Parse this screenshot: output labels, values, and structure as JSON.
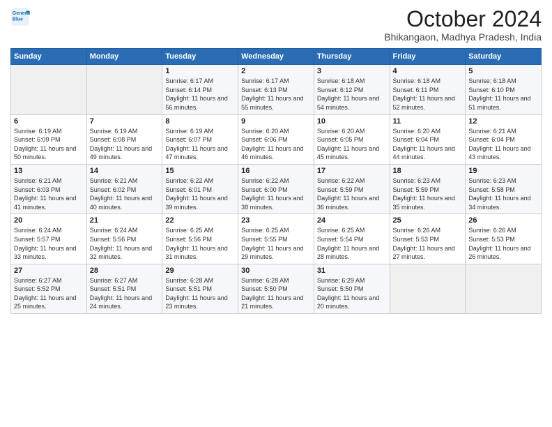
{
  "logo": {
    "line1": "General",
    "line2": "Blue"
  },
  "title": "October 2024",
  "location": "Bhikangaon, Madhya Pradesh, India",
  "header_days": [
    "Sunday",
    "Monday",
    "Tuesday",
    "Wednesday",
    "Thursday",
    "Friday",
    "Saturday"
  ],
  "weeks": [
    [
      {
        "day": "",
        "info": ""
      },
      {
        "day": "",
        "info": ""
      },
      {
        "day": "1",
        "info": "Sunrise: 6:17 AM\nSunset: 6:14 PM\nDaylight: 11 hours and 56 minutes."
      },
      {
        "day": "2",
        "info": "Sunrise: 6:17 AM\nSunset: 6:13 PM\nDaylight: 11 hours and 55 minutes."
      },
      {
        "day": "3",
        "info": "Sunrise: 6:18 AM\nSunset: 6:12 PM\nDaylight: 11 hours and 54 minutes."
      },
      {
        "day": "4",
        "info": "Sunrise: 6:18 AM\nSunset: 6:11 PM\nDaylight: 11 hours and 52 minutes."
      },
      {
        "day": "5",
        "info": "Sunrise: 6:18 AM\nSunset: 6:10 PM\nDaylight: 11 hours and 51 minutes."
      }
    ],
    [
      {
        "day": "6",
        "info": "Sunrise: 6:19 AM\nSunset: 6:09 PM\nDaylight: 11 hours and 50 minutes."
      },
      {
        "day": "7",
        "info": "Sunrise: 6:19 AM\nSunset: 6:08 PM\nDaylight: 11 hours and 49 minutes."
      },
      {
        "day": "8",
        "info": "Sunrise: 6:19 AM\nSunset: 6:07 PM\nDaylight: 11 hours and 47 minutes."
      },
      {
        "day": "9",
        "info": "Sunrise: 6:20 AM\nSunset: 6:06 PM\nDaylight: 11 hours and 46 minutes."
      },
      {
        "day": "10",
        "info": "Sunrise: 6:20 AM\nSunset: 6:05 PM\nDaylight: 11 hours and 45 minutes."
      },
      {
        "day": "11",
        "info": "Sunrise: 6:20 AM\nSunset: 6:04 PM\nDaylight: 11 hours and 44 minutes."
      },
      {
        "day": "12",
        "info": "Sunrise: 6:21 AM\nSunset: 6:04 PM\nDaylight: 11 hours and 43 minutes."
      }
    ],
    [
      {
        "day": "13",
        "info": "Sunrise: 6:21 AM\nSunset: 6:03 PM\nDaylight: 11 hours and 41 minutes."
      },
      {
        "day": "14",
        "info": "Sunrise: 6:21 AM\nSunset: 6:02 PM\nDaylight: 11 hours and 40 minutes."
      },
      {
        "day": "15",
        "info": "Sunrise: 6:22 AM\nSunset: 6:01 PM\nDaylight: 11 hours and 39 minutes."
      },
      {
        "day": "16",
        "info": "Sunrise: 6:22 AM\nSunset: 6:00 PM\nDaylight: 11 hours and 38 minutes."
      },
      {
        "day": "17",
        "info": "Sunrise: 6:22 AM\nSunset: 5:59 PM\nDaylight: 11 hours and 36 minutes."
      },
      {
        "day": "18",
        "info": "Sunrise: 6:23 AM\nSunset: 5:59 PM\nDaylight: 11 hours and 35 minutes."
      },
      {
        "day": "19",
        "info": "Sunrise: 6:23 AM\nSunset: 5:58 PM\nDaylight: 11 hours and 34 minutes."
      }
    ],
    [
      {
        "day": "20",
        "info": "Sunrise: 6:24 AM\nSunset: 5:57 PM\nDaylight: 11 hours and 33 minutes."
      },
      {
        "day": "21",
        "info": "Sunrise: 6:24 AM\nSunset: 5:56 PM\nDaylight: 11 hours and 32 minutes."
      },
      {
        "day": "22",
        "info": "Sunrise: 6:25 AM\nSunset: 5:56 PM\nDaylight: 11 hours and 31 minutes."
      },
      {
        "day": "23",
        "info": "Sunrise: 6:25 AM\nSunset: 5:55 PM\nDaylight: 11 hours and 29 minutes."
      },
      {
        "day": "24",
        "info": "Sunrise: 6:25 AM\nSunset: 5:54 PM\nDaylight: 11 hours and 28 minutes."
      },
      {
        "day": "25",
        "info": "Sunrise: 6:26 AM\nSunset: 5:53 PM\nDaylight: 11 hours and 27 minutes."
      },
      {
        "day": "26",
        "info": "Sunrise: 6:26 AM\nSunset: 5:53 PM\nDaylight: 11 hours and 26 minutes."
      }
    ],
    [
      {
        "day": "27",
        "info": "Sunrise: 6:27 AM\nSunset: 5:52 PM\nDaylight: 11 hours and 25 minutes."
      },
      {
        "day": "28",
        "info": "Sunrise: 6:27 AM\nSunset: 5:51 PM\nDaylight: 11 hours and 24 minutes."
      },
      {
        "day": "29",
        "info": "Sunrise: 6:28 AM\nSunset: 5:51 PM\nDaylight: 11 hours and 23 minutes."
      },
      {
        "day": "30",
        "info": "Sunrise: 6:28 AM\nSunset: 5:50 PM\nDaylight: 11 hours and 21 minutes."
      },
      {
        "day": "31",
        "info": "Sunrise: 6:29 AM\nSunset: 5:50 PM\nDaylight: 11 hours and 20 minutes."
      },
      {
        "day": "",
        "info": ""
      },
      {
        "day": "",
        "info": ""
      }
    ]
  ]
}
